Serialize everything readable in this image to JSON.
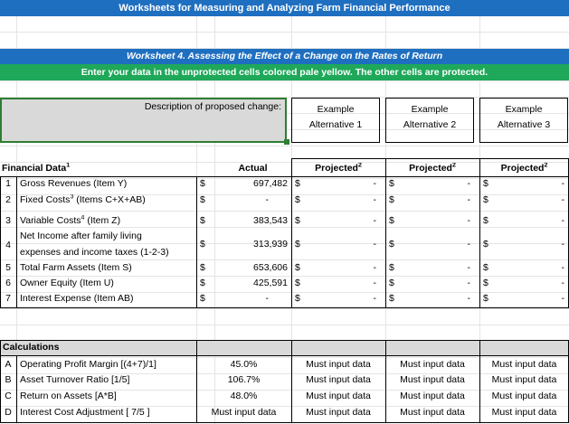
{
  "banner_title": "Worksheets for Measuring and Analyzing Farm Financial Performance",
  "worksheet_title": "Worksheet 4. Assessing the Effect of a Change on the Rates of Return",
  "instructions": "Enter your data in the unprotected cells colored pale yellow. The other cells are protected.",
  "description_label": "Description of proposed change:",
  "alternatives": [
    {
      "line1": "Example",
      "line2": "Alternative 1"
    },
    {
      "line1": "Example",
      "line2": "Alternative 2"
    },
    {
      "line1": "Example",
      "line2": "Alternative 3"
    }
  ],
  "financial": {
    "section_label": "Financial Data",
    "section_sup": "1",
    "actual_label": "Actual",
    "projected_label": "Projected",
    "projected_sup": "2",
    "rows": [
      {
        "num": "1",
        "label": "Gross Revenues (Item Y)",
        "currency": "$",
        "actual": "697,482",
        "p1": "-",
        "p2": "-",
        "p3": "-"
      },
      {
        "num": "2",
        "label": "Fixed Costs",
        "label_sup": "3",
        "label_tail": " (Items C+X+AB)",
        "currency": "$",
        "actual": "-",
        "p1": "-",
        "p2": "-",
        "p3": "-"
      },
      {
        "num": "3",
        "label": "Variable Costs",
        "label_sup": "4",
        "label_tail": " (Item Z)",
        "currency": "$",
        "actual": "383,543",
        "p1": "-",
        "p2": "-",
        "p3": "-"
      },
      {
        "num": "4",
        "label_line1": "Net Income after family living",
        "label_line2": "expenses and income taxes (1-2-3)",
        "currency": "$",
        "actual": "313,939",
        "p1": "-",
        "p2": "-",
        "p3": "-"
      },
      {
        "num": "5",
        "label": "Total Farm Assets (Item S)",
        "currency": "$",
        "actual": "653,606",
        "p1": "-",
        "p2": "-",
        "p3": "-"
      },
      {
        "num": "6",
        "label": "Owner Equity (Item U)",
        "currency": "$",
        "actual": "425,591",
        "p1": "-",
        "p2": "-",
        "p3": "-"
      },
      {
        "num": "7",
        "label": "Interest Expense (Item AB)",
        "currency": "$",
        "actual": "-",
        "p1": "-",
        "p2": "-",
        "p3": "-"
      }
    ]
  },
  "calculations": {
    "section_label": "Calculations",
    "rows": [
      {
        "letter": "A",
        "label": "Operating Profit Margin [(4+7)/1]",
        "actual": "45.0%",
        "p1": "Must input data",
        "p2": "Must input data",
        "p3": "Must input data"
      },
      {
        "letter": "B",
        "label": "Asset Turnover Ratio [1/5]",
        "actual": "106.7%",
        "p1": "Must input data",
        "p2": "Must input data",
        "p3": "Must input data"
      },
      {
        "letter": "C",
        "label": "Return on Assets [A*B]",
        "actual": "48.0%",
        "p1": "Must input data",
        "p2": "Must input data",
        "p3": "Must input data"
      },
      {
        "letter": "D",
        "label": "Interest Cost Adjustment [ 7/5 ]",
        "actual": "Must input data",
        "p1": "Must input data",
        "p2": "Must input data",
        "p3": "Must input data"
      }
    ]
  },
  "colors": {
    "banner_blue": "#1f6fc0",
    "banner_green": "#1fa85a",
    "protected_gray": "#d9d9d9",
    "selection_green": "#2e7d32"
  }
}
